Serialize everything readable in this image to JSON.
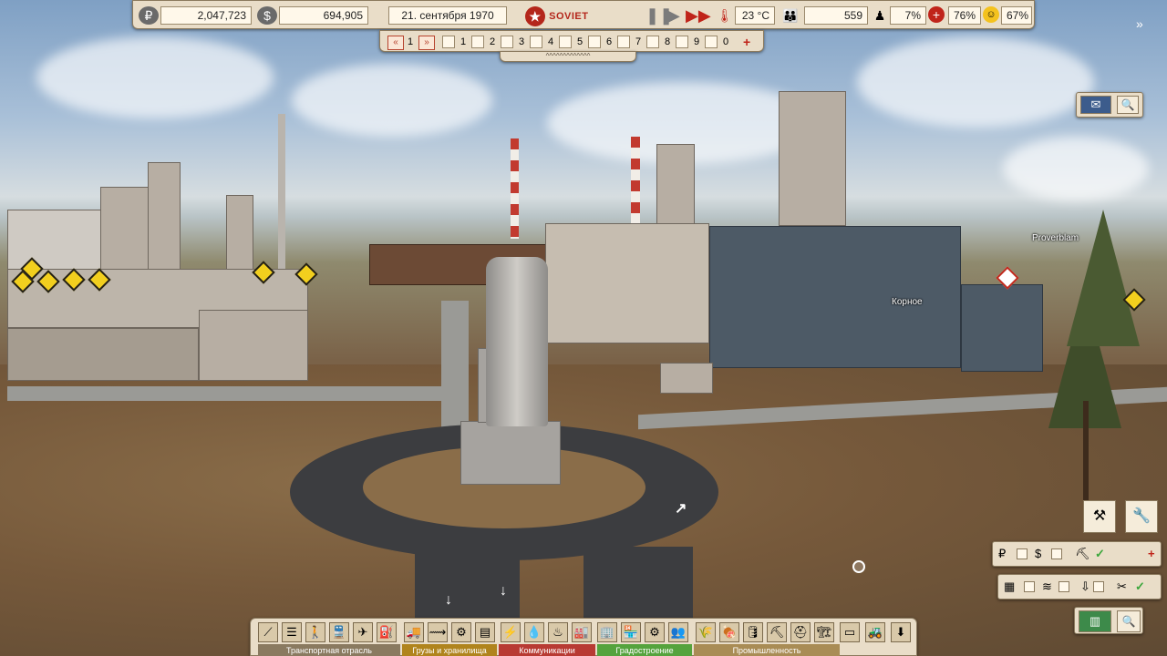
{
  "top": {
    "rubles": "2,047,723",
    "dollars": "694,905",
    "date": "21. сентября 1970",
    "logo_text": "SOVIET REPUBLIC",
    "temperature": "23 °C",
    "population": "559",
    "unemployment": "7%",
    "health": "76%",
    "happiness": "67%"
  },
  "speed": {
    "current": "1",
    "slots": [
      "1",
      "2",
      "3",
      "4",
      "5",
      "6",
      "7",
      "8",
      "9",
      "0"
    ],
    "plus": "+"
  },
  "sub_handle": "^^^^^^^^^^^^^",
  "map_labels": {
    "town1": "Корное",
    "town2": "Proverblam"
  },
  "bottom": {
    "categories": [
      {
        "label": "Транспортная отрасль",
        "color": "#8a7a60"
      },
      {
        "label": "Грузы и хранилища",
        "color": "#b0841d"
      },
      {
        "label": "Коммуникации",
        "color": "#b83a33"
      },
      {
        "label": "Градостроение",
        "color": "#55a33d"
      },
      {
        "label": "Промышленность",
        "color": "#a98c55"
      }
    ]
  },
  "icons": {
    "ruble": "ruble-icon",
    "dollar": "dollar-icon",
    "thermometer": "thermometer-icon",
    "people": "people-icon",
    "worker": "worker-icon",
    "health": "red-cross-icon",
    "happy": "smiley-icon"
  }
}
